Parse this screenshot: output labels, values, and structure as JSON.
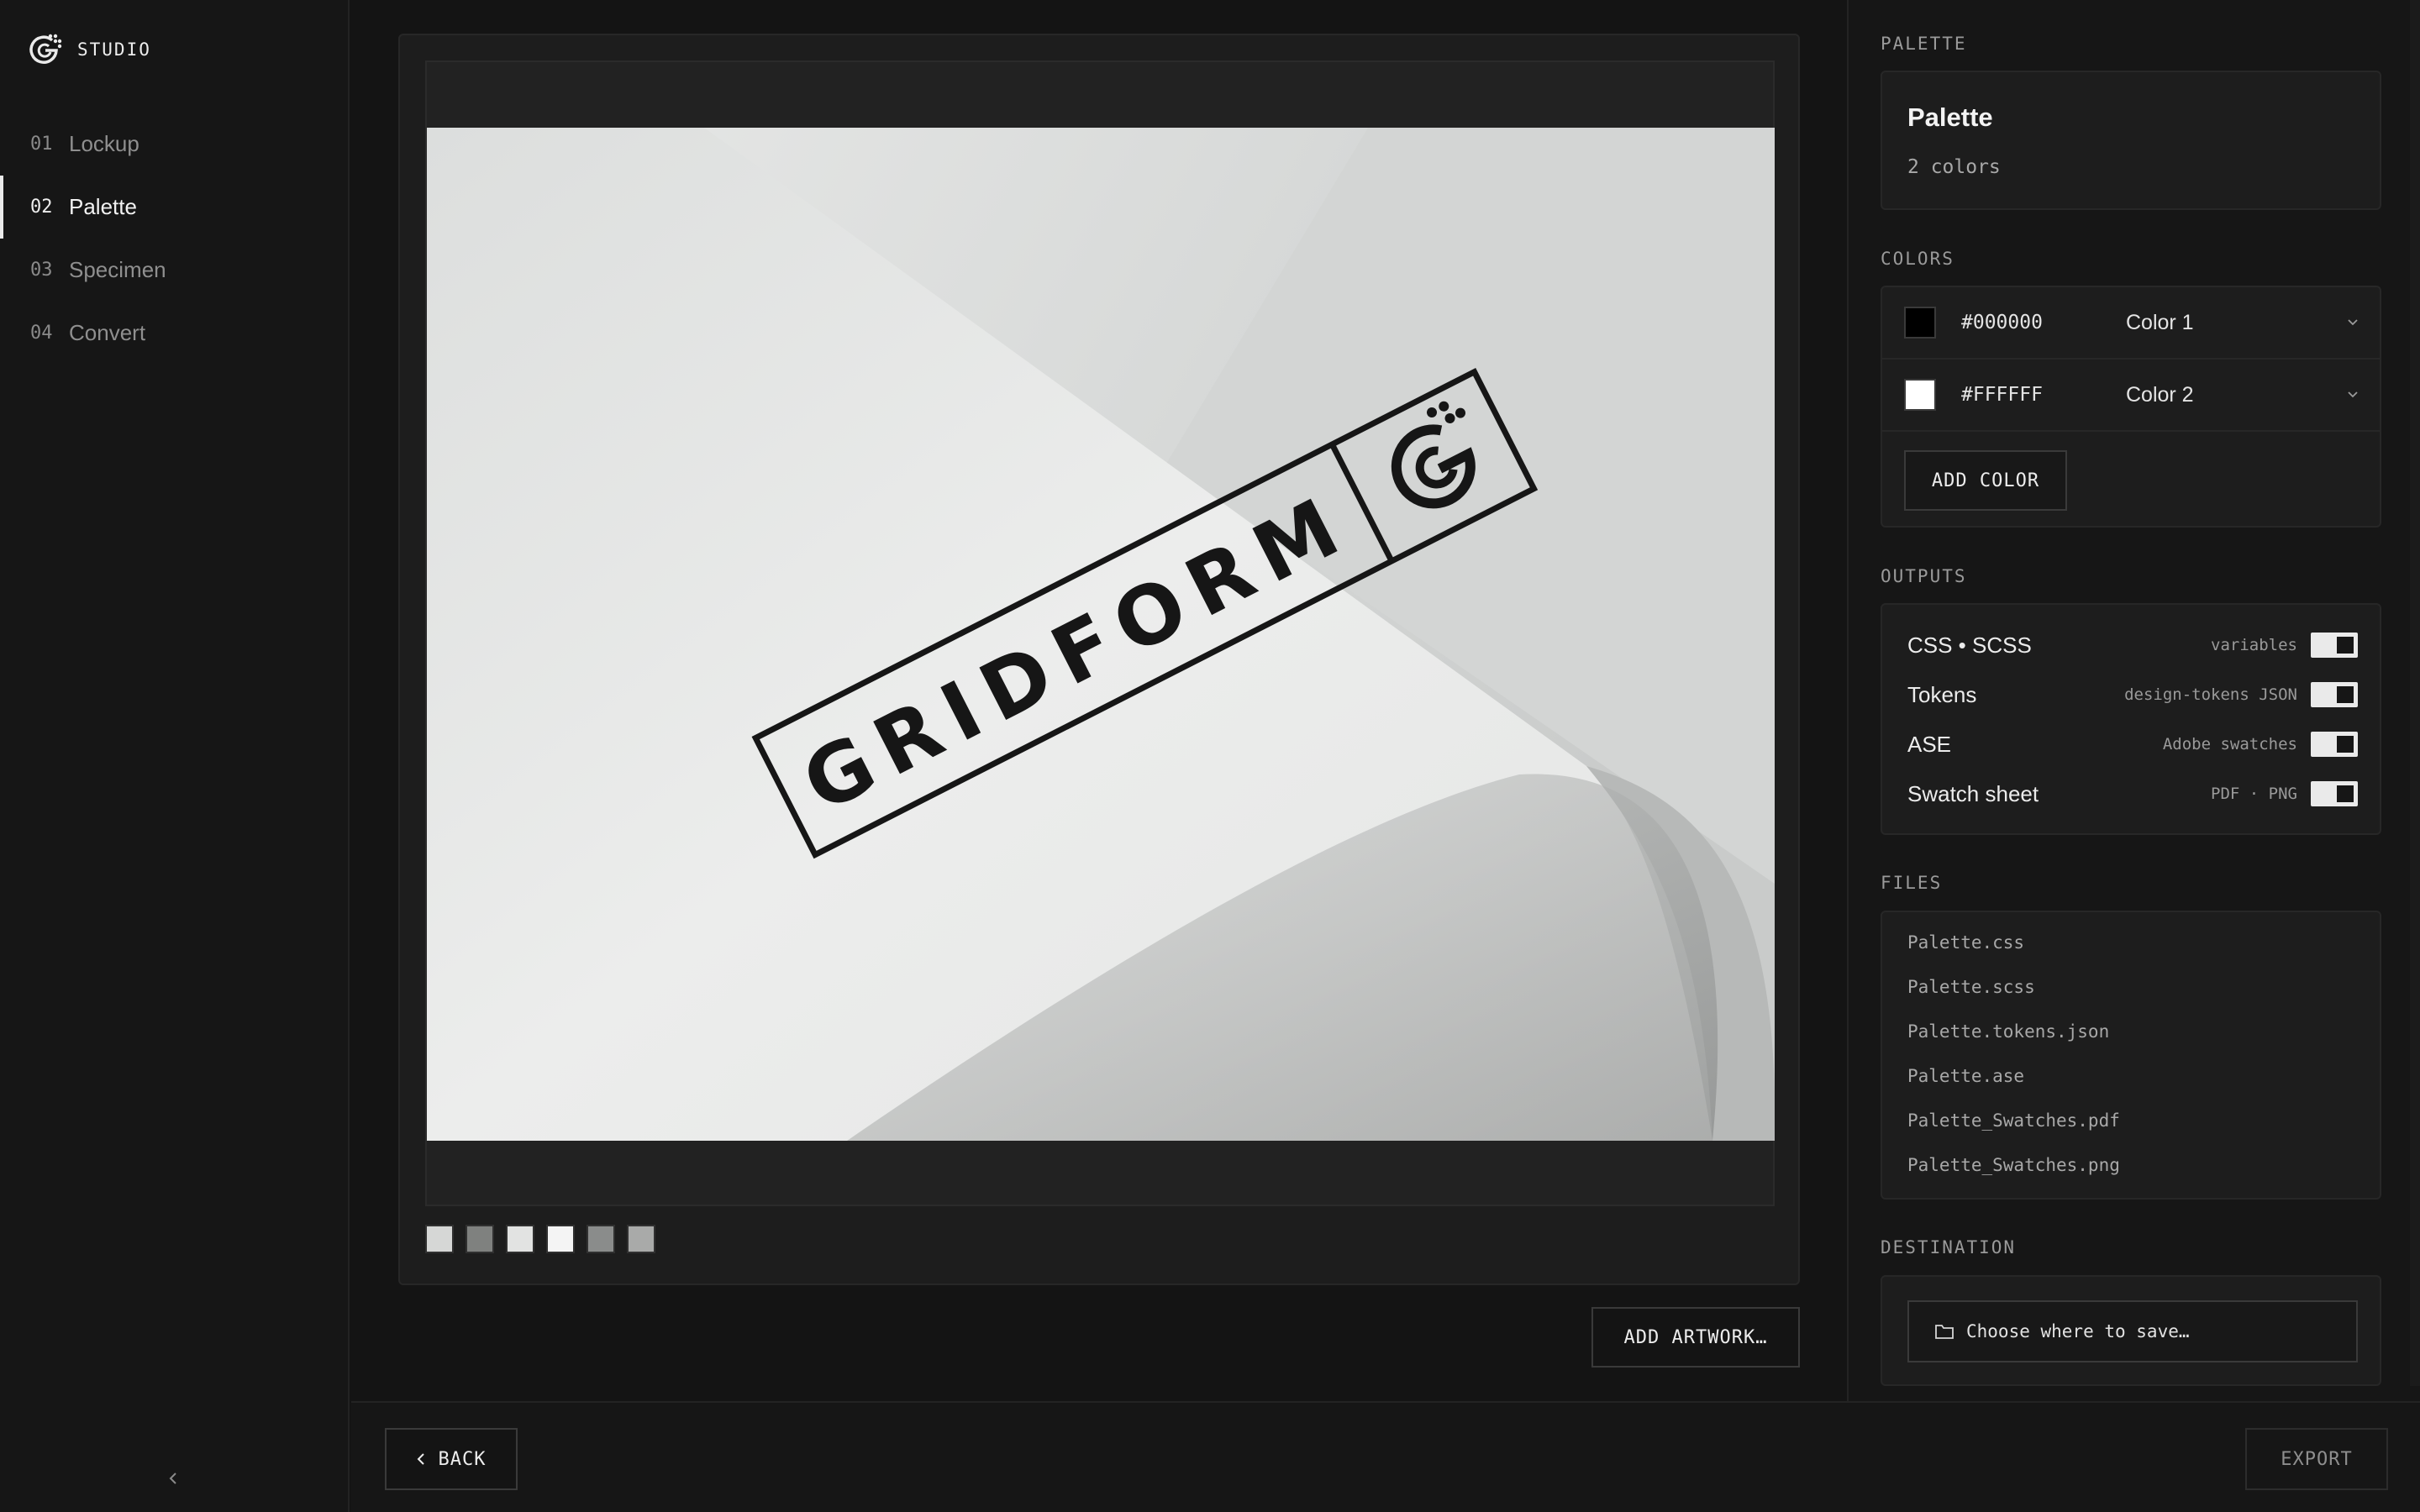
{
  "app": {
    "brand": "STUDIO",
    "accent": "#eaeaea",
    "background": "#141414"
  },
  "sidebar": {
    "items": [
      {
        "num": "01",
        "label": "Lockup"
      },
      {
        "num": "02",
        "label": "Palette",
        "active": true
      },
      {
        "num": "03",
        "label": "Specimen"
      },
      {
        "num": "04",
        "label": "Convert"
      }
    ],
    "collapse_icon": "chevron-left-icon"
  },
  "canvas": {
    "artwork_text": "GRIDFORM",
    "swatches": [
      "#d6d7d6",
      "#7f817f",
      "#e2e3e2",
      "#f4f4f4",
      "#8a8c8b",
      "#a9aaa9"
    ],
    "add_artwork_label": "ADD ARTWORK…"
  },
  "panel": {
    "palette": {
      "section_title": "PALETTE",
      "name": "Palette",
      "count": "2 colors"
    },
    "colors": {
      "section_title": "COLORS",
      "items": [
        {
          "hex": "#000000",
          "name": "Color 1"
        },
        {
          "hex": "#FFFFFF",
          "name": "Color 2"
        }
      ],
      "add_label": "ADD COLOR"
    },
    "outputs": {
      "section_title": "OUTPUTS",
      "items": [
        {
          "label": "CSS • SCSS",
          "note": "variables",
          "enabled": true
        },
        {
          "label": "Tokens",
          "note": "design-tokens JSON",
          "enabled": true
        },
        {
          "label": "ASE",
          "note": "Adobe swatches",
          "enabled": true
        },
        {
          "label": "Swatch sheet",
          "note": "PDF · PNG",
          "enabled": true
        }
      ]
    },
    "files": {
      "section_title": "FILES",
      "items": [
        "Palette.css",
        "Palette.scss",
        "Palette.tokens.json",
        "Palette.ase",
        "Palette_Swatches.pdf",
        "Palette_Swatches.png"
      ]
    },
    "destination": {
      "section_title": "DESTINATION",
      "placeholder": "Choose where to save…"
    }
  },
  "footer": {
    "back_label": "BACK",
    "export_label": "EXPORT"
  }
}
